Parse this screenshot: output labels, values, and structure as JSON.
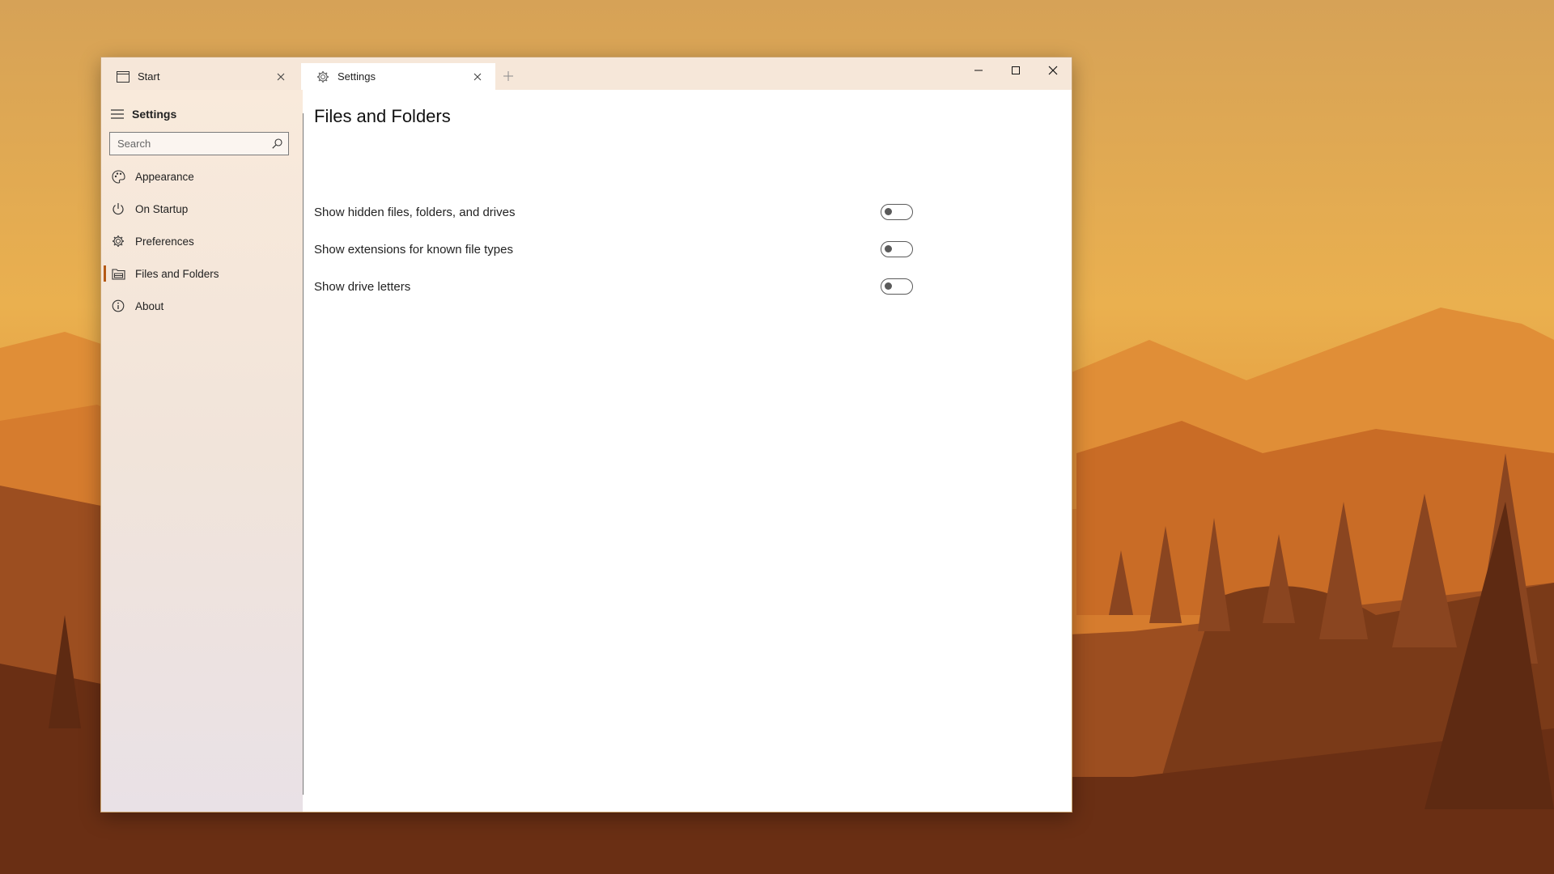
{
  "tabs": [
    {
      "label": "Start",
      "icon": "window-icon"
    },
    {
      "label": "Settings",
      "icon": "gear-icon"
    }
  ],
  "caption_buttons": [
    "minimize-icon",
    "maximize-icon",
    "close-icon"
  ],
  "sidebar": {
    "title": "Settings",
    "search_placeholder": "Search",
    "items": [
      {
        "label": "Appearance",
        "icon": "palette-icon"
      },
      {
        "label": "On Startup",
        "icon": "power-icon"
      },
      {
        "label": "Preferences",
        "icon": "gear-icon"
      },
      {
        "label": "Files and Folders",
        "icon": "folder-icon",
        "active": true
      },
      {
        "label": "About",
        "icon": "info-icon"
      }
    ]
  },
  "main": {
    "title": "Files and Folders",
    "settings": [
      {
        "label": "Show hidden files, folders, and drives",
        "on": false
      },
      {
        "label": "Show extensions for known file types",
        "on": false
      },
      {
        "label": "Show drive letters",
        "on": false
      }
    ]
  },
  "colors": {
    "accent": "#b45a16",
    "tabbar": "#f6e7d9"
  }
}
